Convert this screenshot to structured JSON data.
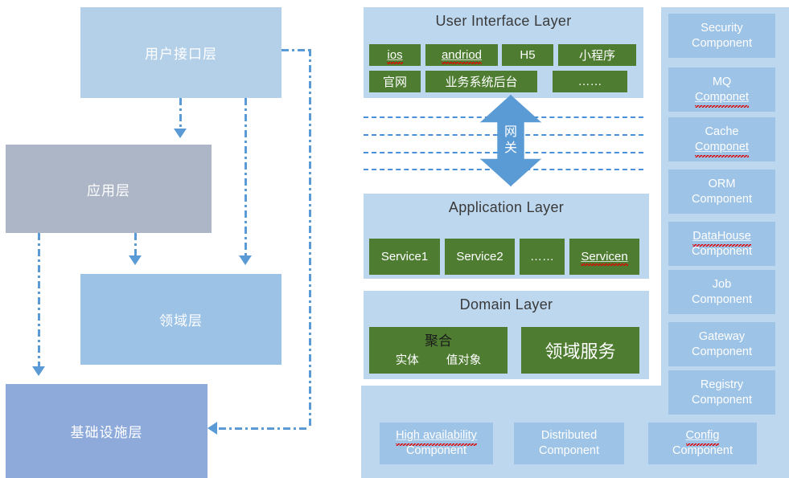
{
  "diagram": {
    "left_layers": [
      {
        "id": "ui",
        "label": "用户接口层"
      },
      {
        "id": "app",
        "label": "应用层"
      },
      {
        "id": "dom",
        "label": "领域层"
      },
      {
        "id": "infra",
        "label": "基础设施层"
      }
    ],
    "ui_layer": {
      "title": "User Interface Layer",
      "row1": [
        {
          "label": "ios",
          "misspelled": true
        },
        {
          "label": "andriod",
          "misspelled": true
        },
        {
          "label": "H5",
          "misspelled": false
        },
        {
          "label": "小程序",
          "misspelled": false
        }
      ],
      "row2": [
        {
          "label": "官网",
          "misspelled": false
        },
        {
          "label": "业务系统后台",
          "misspelled": false
        },
        {
          "label": "……",
          "misspelled": false
        }
      ]
    },
    "gateway": {
      "line1": "网",
      "line2": "关"
    },
    "application_layer": {
      "title": "Application Layer",
      "services": [
        {
          "label": "Service1",
          "misspelled": false
        },
        {
          "label": "Service2",
          "misspelled": false
        },
        {
          "label": "……",
          "misspelled": false
        },
        {
          "label": "Servicen",
          "misspelled": true
        }
      ]
    },
    "domain_layer": {
      "title": "Domain Layer",
      "aggregate": {
        "title": "聚合",
        "entity": "实体",
        "value_object": "值对象"
      },
      "domain_service": "领域服务"
    },
    "infrastructure_components_bottom": [
      {
        "line1": "High availability",
        "line2": "Component",
        "misspelled": true
      },
      {
        "line1": "Distributed",
        "line2": "Component",
        "misspelled": false
      },
      {
        "line1": "Config",
        "line2": "Component",
        "misspelled": true
      }
    ],
    "infrastructure_components_side": [
      {
        "line1": "Security",
        "line2": "Component",
        "misspelled": false
      },
      {
        "line1": "MQ",
        "line2": "Componet",
        "misspelled": true
      },
      {
        "line1": "Cache",
        "line2": "Componet",
        "misspelled": true
      },
      {
        "line1": "ORM",
        "line2": "Component",
        "misspelled": false
      },
      {
        "line1": "DataHouse",
        "line2": "Component",
        "misspelled": true
      },
      {
        "line1": "Job",
        "line2": "Component",
        "misspelled": false
      },
      {
        "line1": "Gateway",
        "line2": "Component",
        "misspelled": false
      },
      {
        "line1": "Registry",
        "line2": "Component",
        "misspelled": false
      }
    ],
    "colors": {
      "panel_blue": "#bdd7ee",
      "chip_blue": "#9dc3e6",
      "green": "#4e7d32",
      "arrow_blue": "#5b9bd5",
      "ui_layer_box": "#b4d0e9",
      "app_layer_box": "#acb6c7",
      "domain_layer_box": "#9cc3e5",
      "infra_layer_box": "#8eaadb",
      "spellcheck_red": "#e00000"
    }
  }
}
